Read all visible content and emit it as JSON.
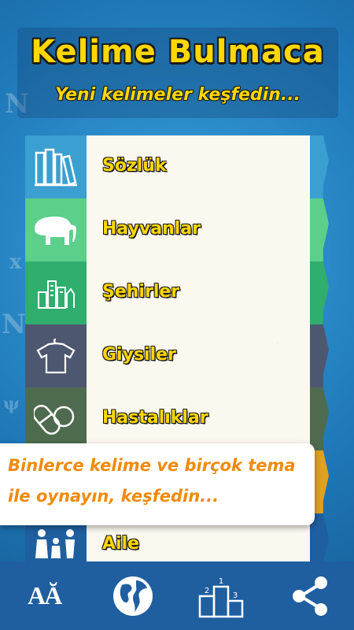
{
  "header": {
    "title": "Kelime Bulmaca",
    "subtitle": "Yeni kelimeler keşfedin..."
  },
  "categories": [
    {
      "label": "Sözlük",
      "icon": "books-icon",
      "color": "#3b9fd1"
    },
    {
      "label": "Hayvanlar",
      "icon": "elephant-icon",
      "color": "#5ccf8b"
    },
    {
      "label": "Şehirler",
      "icon": "city-icon",
      "color": "#2fae6e"
    },
    {
      "label": "Giysiler",
      "icon": "tshirt-icon",
      "color": "#4e5770"
    },
    {
      "label": "Hastalıklar",
      "icon": "pills-icon",
      "color": "#4f6b4f"
    },
    {
      "label": "",
      "icon": "",
      "color": "#e0a020"
    },
    {
      "label": "Aile",
      "icon": "family-icon",
      "color": "#1f5fa0"
    }
  ],
  "banner": {
    "line1": "Binlerce kelime ve birçok tema",
    "line2": "ile oynayın, keşfedin..."
  },
  "bottom_bar": {
    "font_icon_text": "AĂ",
    "podium": [
      "2",
      "1",
      "3"
    ],
    "items": [
      "font-size-icon",
      "globe-icon",
      "leaderboard-icon",
      "share-icon"
    ]
  },
  "colors": {
    "title": "#ffd700",
    "banner_text": "#f08a0a",
    "bottom_bar": "#1f5fa0"
  }
}
